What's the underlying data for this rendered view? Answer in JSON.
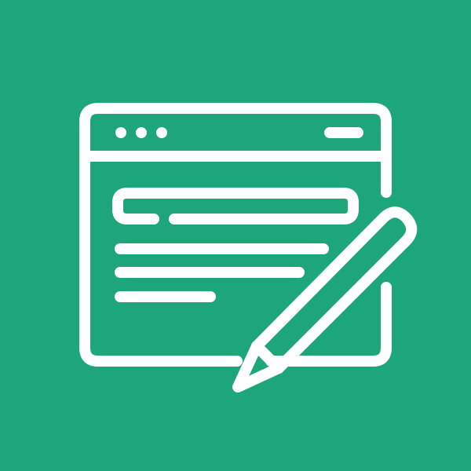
{
  "icon": {
    "name": "web-form-editing-icon",
    "background_color": "#1ca67a",
    "stroke_color": "#ffffff",
    "elements": [
      "browser-window-icon",
      "window-dot-icon",
      "window-dot-icon",
      "window-dot-icon",
      "window-dash-icon",
      "text-input-field-icon",
      "text-line-icon",
      "text-line-icon",
      "text-line-icon",
      "pencil-icon"
    ]
  }
}
